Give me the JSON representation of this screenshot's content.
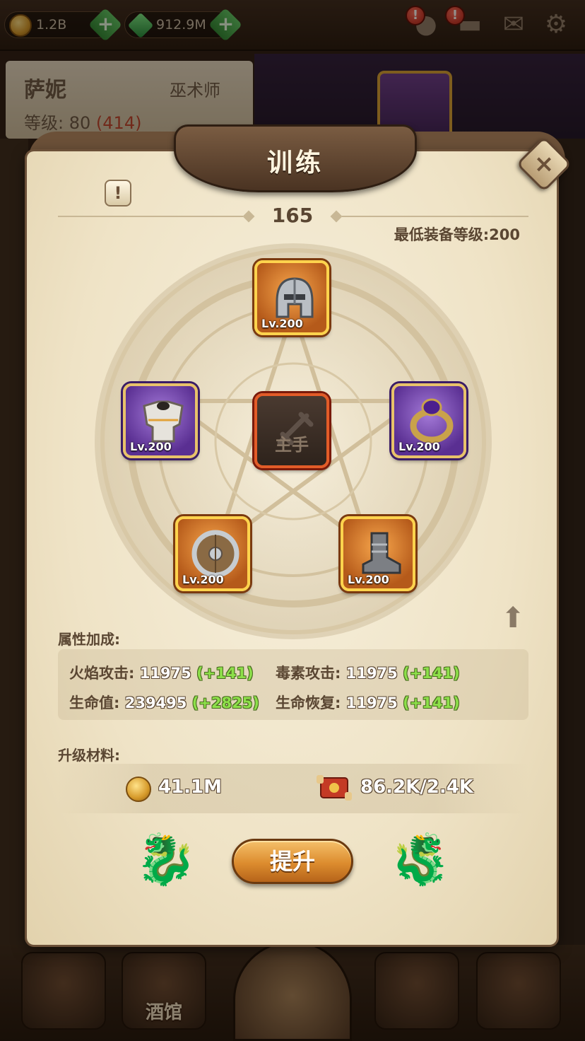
{
  "topbar": {
    "coins": "1.2B",
    "gems": "912.9M",
    "alerts": [
      "!",
      "!"
    ]
  },
  "hero": {
    "name": "萨妮",
    "class": "巫术师",
    "level_label": "等级:",
    "level": "80",
    "level_extra": "(414)"
  },
  "dialog": {
    "title": "训练",
    "close_symbol": "×",
    "info_symbol": "!",
    "training_level": "165",
    "min_equipment_level": "最低装备等级:200",
    "slots": {
      "helmet": {
        "level": "Lv.200"
      },
      "armor": {
        "level": "Lv.200"
      },
      "main_hand": {
        "caption": "主手"
      },
      "ring": {
        "level": "Lv.200"
      },
      "shield": {
        "level": "Lv.200"
      },
      "boots": {
        "level": "Lv.200"
      }
    },
    "attributes_label": "属性加成:",
    "attributes": [
      {
        "name": "火焰攻击:",
        "value": "11975",
        "bonus": "(+141)"
      },
      {
        "name": "毒素攻击:",
        "value": "11975",
        "bonus": "(+141)"
      },
      {
        "name": "生命值:",
        "value": "239495",
        "bonus": "(+2825)"
      },
      {
        "name": "生命恢复:",
        "value": "11975",
        "bonus": "(+141)"
      }
    ],
    "materials_label": "升级材料:",
    "materials": {
      "coins": "41.1M",
      "scrolls": "86.2K/2.4K"
    },
    "upgrade_label": "提升"
  },
  "bottom_nav": {
    "tavern_label": "酒馆"
  },
  "colors": {
    "parchment": "#efe3c6",
    "bonus_green": "#8de04a",
    "slot_orange": "#e0801f",
    "slot_purple": "#7a4bb8",
    "close_accent": "#6b5038"
  }
}
